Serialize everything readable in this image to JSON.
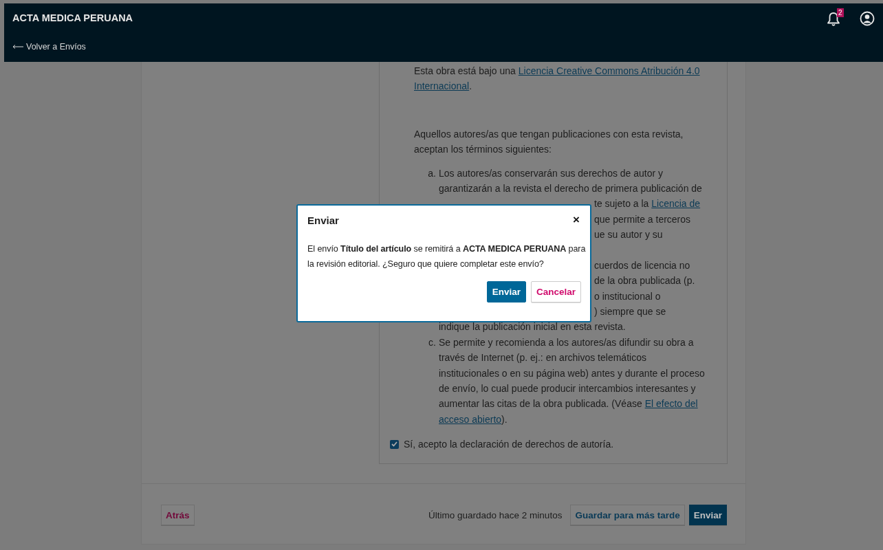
{
  "header": {
    "title": "ACTA MEDICA PERUANA",
    "back_link": "Volver a Envíos",
    "notifications": {
      "count": "2"
    }
  },
  "rights_statement": {
    "blocks": [
      {
        "kind": "paragraph",
        "lines": [
          {
            "kind": "full",
            "text": "Esta obra está bajo una ",
            "link": "Licencia Creative Commons Atribución 4.0"
          },
          {
            "kind": "full",
            "link": "Internacional",
            "after": "."
          }
        ]
      },
      {
        "kind": "paragraph",
        "lines": [
          {
            "kind": "full",
            "text": "Aquellos autores/as que tengan publicaciones con esta revista,"
          },
          {
            "kind": "full",
            "text": "aceptan los términos siguientes:"
          }
        ]
      },
      {
        "kind": "list",
        "items": [
          {
            "marker": "a.",
            "lines": [
              {
                "kind": "full",
                "text": "Los autores/as conservarán sus derechos de autor y"
              },
              {
                "kind": "full",
                "text": "garantizarán a la revista el derecho de primera publicación de"
              },
              {
                "kind": "fragment",
                "text": "te sujeto a la ",
                "link": "Licencia de"
              },
              {
                "kind": "fragment",
                "text": "que permite a terceros"
              },
              {
                "kind": "fragment",
                "text": "ue su autor y su"
              },
              {
                "kind": "covered"
              }
            ]
          },
          {
            "lines": [
              {
                "kind": "fragment",
                "text": "cuerdos de licencia no"
              },
              {
                "kind": "fragment",
                "text": "de la obra publicada (p."
              },
              {
                "kind": "fragment",
                "text": "o institucional o"
              },
              {
                "kind": "fragment",
                "text": ") siempre que se"
              },
              {
                "kind": "full",
                "text": "indique la publicación inicial en esta revista."
              }
            ]
          },
          {
            "marker": "c.",
            "lines": [
              {
                "kind": "full",
                "text": "Se permite y recomienda a los autores/as difundir su obra a"
              },
              {
                "kind": "full",
                "text": "través de Internet (p. ej.: en archivos telemáticos"
              },
              {
                "kind": "full",
                "text": "institucionales o en su página web) antes y durante el proceso"
              },
              {
                "kind": "full",
                "text": "de envío, lo cual puede producir intercambios interesantes y"
              },
              {
                "kind": "full",
                "text": "aumentar las citas de la obra publicada. (Véase ",
                "link": "El efecto del"
              },
              {
                "kind": "full",
                "link": "acceso abierto",
                "after": ")."
              }
            ]
          }
        ]
      }
    ],
    "agreement": {
      "label": "Sí, acepto la declaración de derechos de autoría.",
      "checked": true
    }
  },
  "footer": {
    "back_button": "Atrás",
    "last_saved": "Último guardado hace 2 minutos",
    "save_button": "Guardar para más tarde",
    "submit_button": "Enviar"
  },
  "dialog": {
    "title": "Enviar",
    "close": "×",
    "message": "El envío **Título del artículo** se remitirá a **ACTA MEDICA PERUANA** para la revisión editorial. ¿Seguro que quiere completar este envío?",
    "confirm_button": "Enviar",
    "cancel_button": "Cancelar"
  }
}
